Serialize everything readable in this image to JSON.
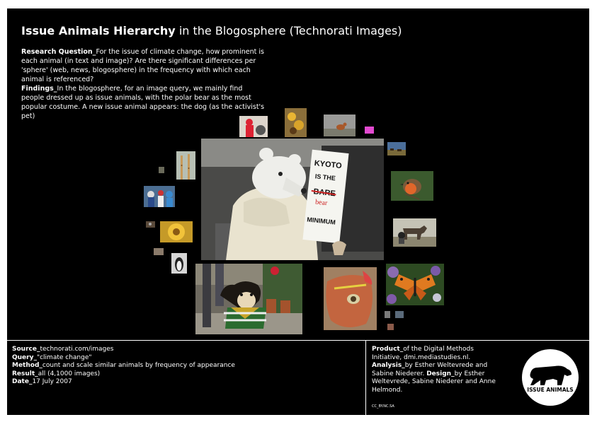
{
  "header": {
    "title_bold": "Issue Animals Hierarchy",
    "title_rest": " in the Blogosphere (Technorati Images)"
  },
  "description": {
    "rq_label": "Research Question_",
    "rq_text": "For the issue of climate change, how prominent is each animal (in text and image)? Are there significant differences per 'sphere' (web, news, blogosphere) in the frequency with which each animal is referenced?",
    "findings_label": "Findings_",
    "findings_text": "In the blogosphere, for an image query, we mainly find people dressed up as issue animals, with the polar bear as the most popular costume. A new issue animal appears: the dog (as the activist's pet)"
  },
  "main_image": {
    "sign_line1": "KYOTO",
    "sign_line2": "IS THE",
    "sign_line3": "BARE",
    "sign_line4": "bear",
    "sign_line5": "MINIMUM"
  },
  "thumbnails": [
    {
      "name": "polar-bear-costume-photo",
      "desc": "person in polar bear costume holding sign"
    },
    {
      "name": "dog-activist-photo",
      "desc": "dog dressed in costume"
    },
    {
      "name": "frog-photo",
      "desc": "frog held in hand"
    },
    {
      "name": "butterfly-photo",
      "desc": "butterfly on flowers"
    },
    {
      "name": "robin-photo",
      "desc": "robin bird"
    },
    {
      "name": "horse-photo",
      "desc": "horses"
    },
    {
      "name": "giraffe-photo",
      "desc": "giraffes"
    },
    {
      "name": "crowd-costume-photo",
      "desc": "people in animal costumes"
    },
    {
      "name": "flower-photo",
      "desc": "yellow flower"
    },
    {
      "name": "penguin-photo",
      "desc": "penguin"
    },
    {
      "name": "red-costume-photo",
      "desc": "person in red costume"
    },
    {
      "name": "bird-feeder-photo",
      "desc": "birds"
    },
    {
      "name": "kangaroo-photo",
      "desc": "small animal"
    },
    {
      "name": "pink-photo",
      "desc": "pink image"
    },
    {
      "name": "cattle-photo",
      "desc": "field with animals"
    }
  ],
  "footer": {
    "source_label": "Source_",
    "source_text": "technorati.com/images",
    "query_label": "Query_",
    "query_text": "\"climate change\"",
    "method_label": "Method_",
    "method_text": "count and scale similar animals by frequency of appearance",
    "result_label": "Result_",
    "result_text": "all (4,1000 images)",
    "date_label": "Date_",
    "date_text": "17 July 2007",
    "product_label": "Product_",
    "product_text": "of the Digital Methods Initiative, dmi.mediastudies.nl. ",
    "analysis_label": "Analysis_",
    "analysis_text": "by Esther Weltevrede and Sabine Niederer. ",
    "design_label": "Design_",
    "design_text": "by Esther Weltevrede, Sabine Niederer and Anne Helmond.",
    "license": "CC_BY.NC.SA"
  },
  "logo": {
    "text": "ISSUE ANIMALS"
  },
  "colors": {
    "background": "#000000",
    "text": "#ffffff",
    "border": "#ffffff"
  }
}
